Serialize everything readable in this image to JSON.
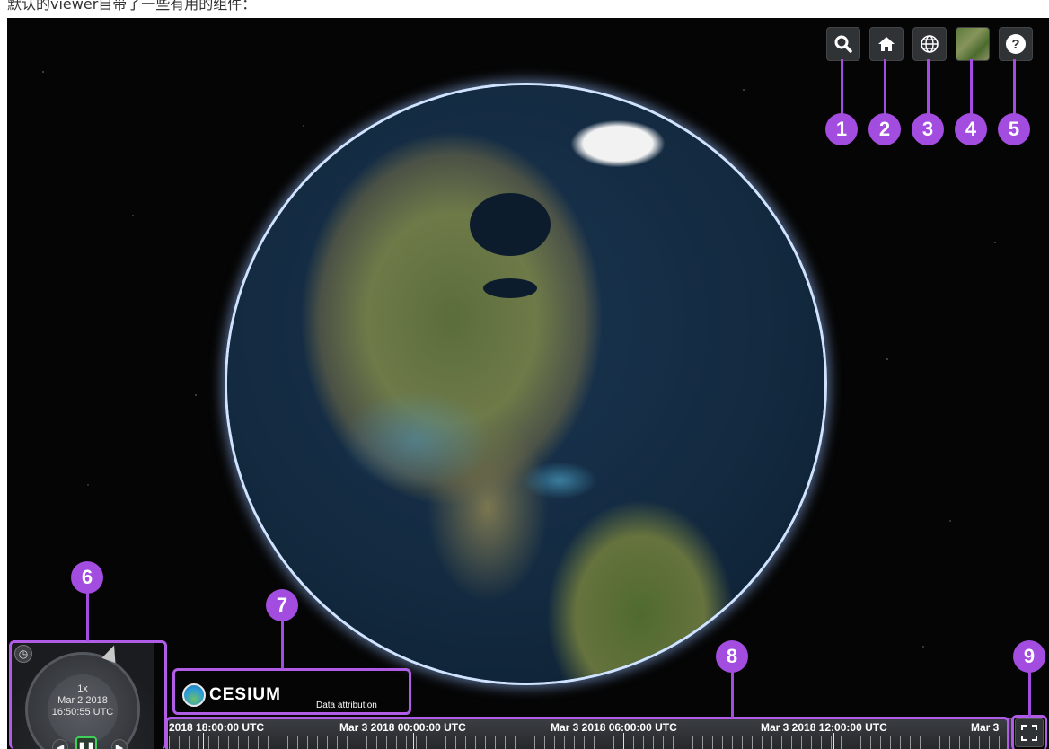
{
  "caption": "默认的viewer自带了一些有用的组件：",
  "toolbar": {
    "geocoder_icon": "search-icon",
    "home_icon": "home-icon",
    "scene_mode_icon": "globe-icon",
    "base_layer_icon": "imagery-thumbnail",
    "help_icon": "help-icon",
    "help_label": "?"
  },
  "markers": [
    "1",
    "2",
    "3",
    "4",
    "5",
    "6",
    "7",
    "8",
    "9"
  ],
  "animation": {
    "speed": "1x",
    "date": "Mar 2 2018",
    "time": "16:50:55 UTC"
  },
  "credits": {
    "logo_text": "CESIUM",
    "attribution_link": "Data attribution"
  },
  "timeline": {
    "labels": [
      "2018 18:00:00 UTC",
      "Mar 3 2018 00:00:00 UTC",
      "Mar 3 2018 06:00:00 UTC",
      "Mar 3 2018 12:00:00 UTC",
      "Mar 3"
    ]
  },
  "colors": {
    "callout": "#a24ce0",
    "toolbar_bg": "#303336",
    "pause_highlight": "#3fd05a"
  }
}
